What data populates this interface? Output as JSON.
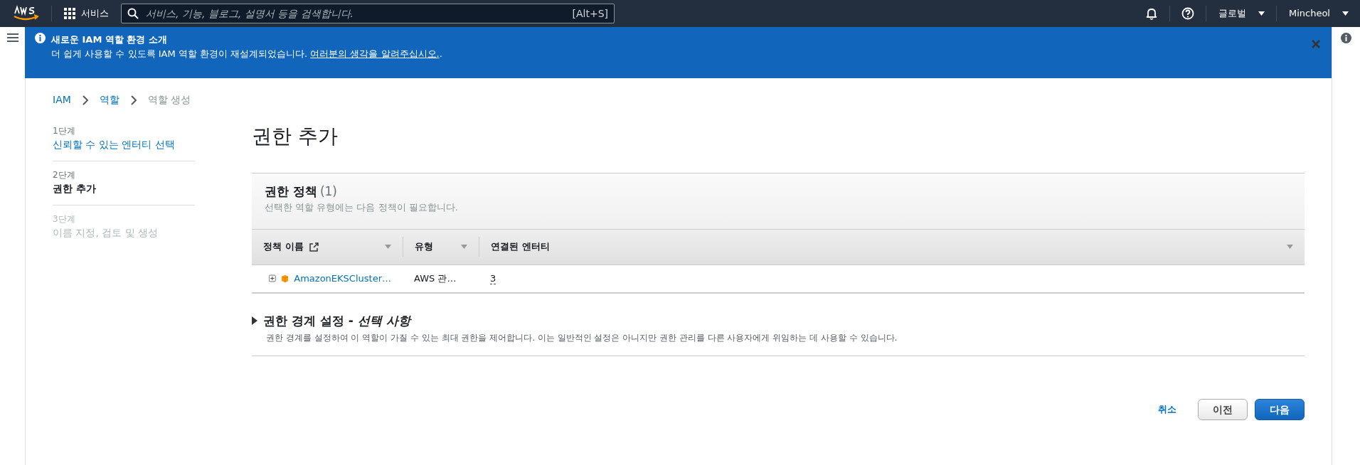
{
  "topbar": {
    "services_label": "서비스",
    "search": {
      "placeholder": "서비스, 기능, 블로그, 설명서 등을 검색합니다.",
      "shortcut": "[Alt+S]"
    },
    "region": "글로벌",
    "user": "Mincheol"
  },
  "banner": {
    "title": "새로운 IAM 역할 환경 소개",
    "text": "더 쉽게 사용할 수 있도록 IAM 역할 환경이 재설계되었습니다. ",
    "link": "여러분의 생각을 알려주십시오.",
    "after": "."
  },
  "breadcrumb": [
    {
      "label": "IAM",
      "link": true
    },
    {
      "label": "역할",
      "link": true
    },
    {
      "label": "역할 생성",
      "link": false
    }
  ],
  "steps": [
    {
      "step": "1단계",
      "label": "신뢰할 수 있는 엔터티 선택",
      "completed": true,
      "selected": false
    },
    {
      "step": "2단계",
      "label": "권한 추가",
      "completed": false,
      "selected": true
    },
    {
      "step": "3단계",
      "label": "이름 지정, 검토 및 생성",
      "completed": false,
      "selected": false
    }
  ],
  "page_title": "권한 추가",
  "policies": {
    "title": "권한 정책",
    "count": "(1)",
    "description": "선택한 역할 유형에는 다음 정책이 필요합니다.",
    "columns": [
      {
        "label": "정책 이름",
        "external_link": true
      },
      {
        "label": "유형",
        "external_link": false
      },
      {
        "label": "연결된 엔터티",
        "external_link": false
      }
    ],
    "rows": [
      {
        "expanded": false,
        "name": "AmazonEKSCluster…",
        "type": "AWS 관…",
        "entities": "3"
      }
    ]
  },
  "boundary": {
    "title": "권한 경계 설정 - ",
    "title_italic": "선택 사항",
    "expanded": false,
    "description": "권한 경계를 설정하여 이 역할이 가질 수 있는 최대 권한을 제어합니다. 이는 일반적인 설정은 아니지만 권한 관리를 다른 사용자에게 위임하는 데 사용할 수 있습니다."
  },
  "actions": {
    "cancel": "취소",
    "previous": "이전",
    "next": "다음"
  }
}
